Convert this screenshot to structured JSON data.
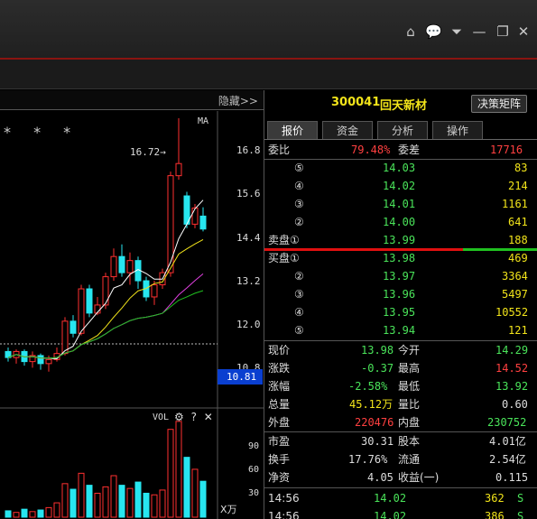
{
  "window": {
    "controls": [
      "home-icon",
      "chat-icon",
      "dropdown-icon",
      "minimize-icon",
      "restore-icon",
      "close-icon"
    ]
  },
  "chart": {
    "hide_label": "隐藏>>",
    "ma_label": "MA",
    "stars": "* * *",
    "high_annotation": "16.72→",
    "y_ticks": [
      "16.8",
      "15.6",
      "14.4",
      "13.2",
      "12.0",
      "10.8"
    ],
    "current_price": "10.81",
    "vol_label": "VOL",
    "vol_ticks": [
      "90",
      "60",
      "30"
    ],
    "vol_unit": "X万"
  },
  "chart_data": {
    "type": "candlestick",
    "ylim": [
      10.2,
      16.9
    ],
    "candles": [
      {
        "o": 10.95,
        "c": 10.8,
        "h": 11.05,
        "l": 10.7
      },
      {
        "o": 10.8,
        "c": 10.95,
        "h": 11.0,
        "l": 10.65
      },
      {
        "o": 10.95,
        "c": 10.7,
        "h": 11.0,
        "l": 10.6
      },
      {
        "o": 10.7,
        "c": 10.85,
        "h": 10.95,
        "l": 10.55
      },
      {
        "o": 10.85,
        "c": 10.65,
        "h": 10.9,
        "l": 10.5
      },
      {
        "o": 10.65,
        "c": 10.75,
        "h": 10.85,
        "l": 10.45
      },
      {
        "o": 10.75,
        "c": 10.9,
        "h": 11.05,
        "l": 10.7
      },
      {
        "o": 10.9,
        "c": 11.7,
        "h": 11.8,
        "l": 10.85
      },
      {
        "o": 11.7,
        "c": 11.4,
        "h": 11.85,
        "l": 11.3
      },
      {
        "o": 11.4,
        "c": 12.5,
        "h": 12.6,
        "l": 11.35
      },
      {
        "o": 12.5,
        "c": 11.9,
        "h": 12.6,
        "l": 11.8
      },
      {
        "o": 11.9,
        "c": 12.1,
        "h": 12.3,
        "l": 11.85
      },
      {
        "o": 12.1,
        "c": 12.8,
        "h": 12.9,
        "l": 12.0
      },
      {
        "o": 12.8,
        "c": 13.3,
        "h": 13.5,
        "l": 12.7
      },
      {
        "o": 13.3,
        "c": 12.9,
        "h": 13.6,
        "l": 12.8
      },
      {
        "o": 12.9,
        "c": 13.2,
        "h": 13.4,
        "l": 12.6
      },
      {
        "o": 13.2,
        "c": 12.7,
        "h": 13.3,
        "l": 12.5
      },
      {
        "o": 12.7,
        "c": 12.3,
        "h": 12.8,
        "l": 12.2
      },
      {
        "o": 12.3,
        "c": 12.6,
        "h": 12.7,
        "l": 12.1
      },
      {
        "o": 12.6,
        "c": 12.9,
        "h": 13.0,
        "l": 12.5
      },
      {
        "o": 12.9,
        "c": 15.3,
        "h": 15.4,
        "l": 12.8
      },
      {
        "o": 15.3,
        "c": 15.6,
        "h": 16.72,
        "l": 15.2
      },
      {
        "o": 14.8,
        "c": 14.1,
        "h": 14.9,
        "l": 14.0
      },
      {
        "o": 14.1,
        "c": 14.5,
        "h": 14.6,
        "l": 14.0
      },
      {
        "o": 14.3,
        "c": 13.98,
        "h": 14.52,
        "l": 13.92
      }
    ],
    "volumes": [
      8,
      6,
      10,
      7,
      9,
      12,
      18,
      42,
      35,
      55,
      40,
      30,
      38,
      52,
      40,
      36,
      44,
      30,
      28,
      34,
      110,
      120,
      75,
      60,
      45
    ]
  },
  "stock": {
    "code": "300041",
    "name": "回天新材",
    "decision_button": "决策矩阵"
  },
  "tabs": [
    "报价",
    "资金",
    "分析",
    "操作"
  ],
  "order_book": {
    "ratio_label": "委比",
    "ratio_value": "79.48%",
    "diff_label": "委差",
    "diff_value": "17716",
    "asks": [
      {
        "level": "⑤",
        "price": "14.03",
        "vol": "83"
      },
      {
        "level": "④",
        "price": "14.02",
        "vol": "214"
      },
      {
        "level": "③",
        "price": "14.01",
        "vol": "1161"
      },
      {
        "level": "②",
        "price": "14.00",
        "vol": "641"
      },
      {
        "level": "卖盘①",
        "price": "13.99",
        "vol": "188"
      }
    ],
    "bids": [
      {
        "level": "买盘①",
        "price": "13.98",
        "vol": "469"
      },
      {
        "level": "②",
        "price": "13.97",
        "vol": "3364"
      },
      {
        "level": "③",
        "price": "13.96",
        "vol": "5497"
      },
      {
        "level": "④",
        "price": "13.95",
        "vol": "10552"
      },
      {
        "level": "⑤",
        "price": "13.94",
        "vol": "121"
      }
    ]
  },
  "quote": {
    "current_label": "现价",
    "current": "13.98",
    "open_label": "今开",
    "open": "14.29",
    "change_label": "涨跌",
    "change": "-0.37",
    "high_label": "最高",
    "high": "14.52",
    "pct_label": "涨幅",
    "pct": "-2.58%",
    "low_label": "最低",
    "low": "13.92",
    "volume_label": "总量",
    "volume": "45.12万",
    "vratio_label": "量比",
    "vratio": "0.60",
    "outer_label": "外盘",
    "outer": "220476",
    "inner_label": "内盘",
    "inner": "230752"
  },
  "fundamentals": {
    "pe_label": "市盈",
    "pe": "30.31",
    "capital_label": "股本",
    "capital": "4.01亿",
    "turnover_label": "换手",
    "turnover": "17.76%",
    "float_label": "流通",
    "float": "2.54亿",
    "nav_label": "净资",
    "nav": "4.05",
    "eps_label": "收益(一)",
    "eps": "0.115"
  },
  "ticks": [
    {
      "time": "14:56",
      "price": "14.02",
      "vol": "362",
      "side": "S"
    },
    {
      "time": "14:56",
      "price": "14.02",
      "vol": "386",
      "side": "S"
    }
  ]
}
